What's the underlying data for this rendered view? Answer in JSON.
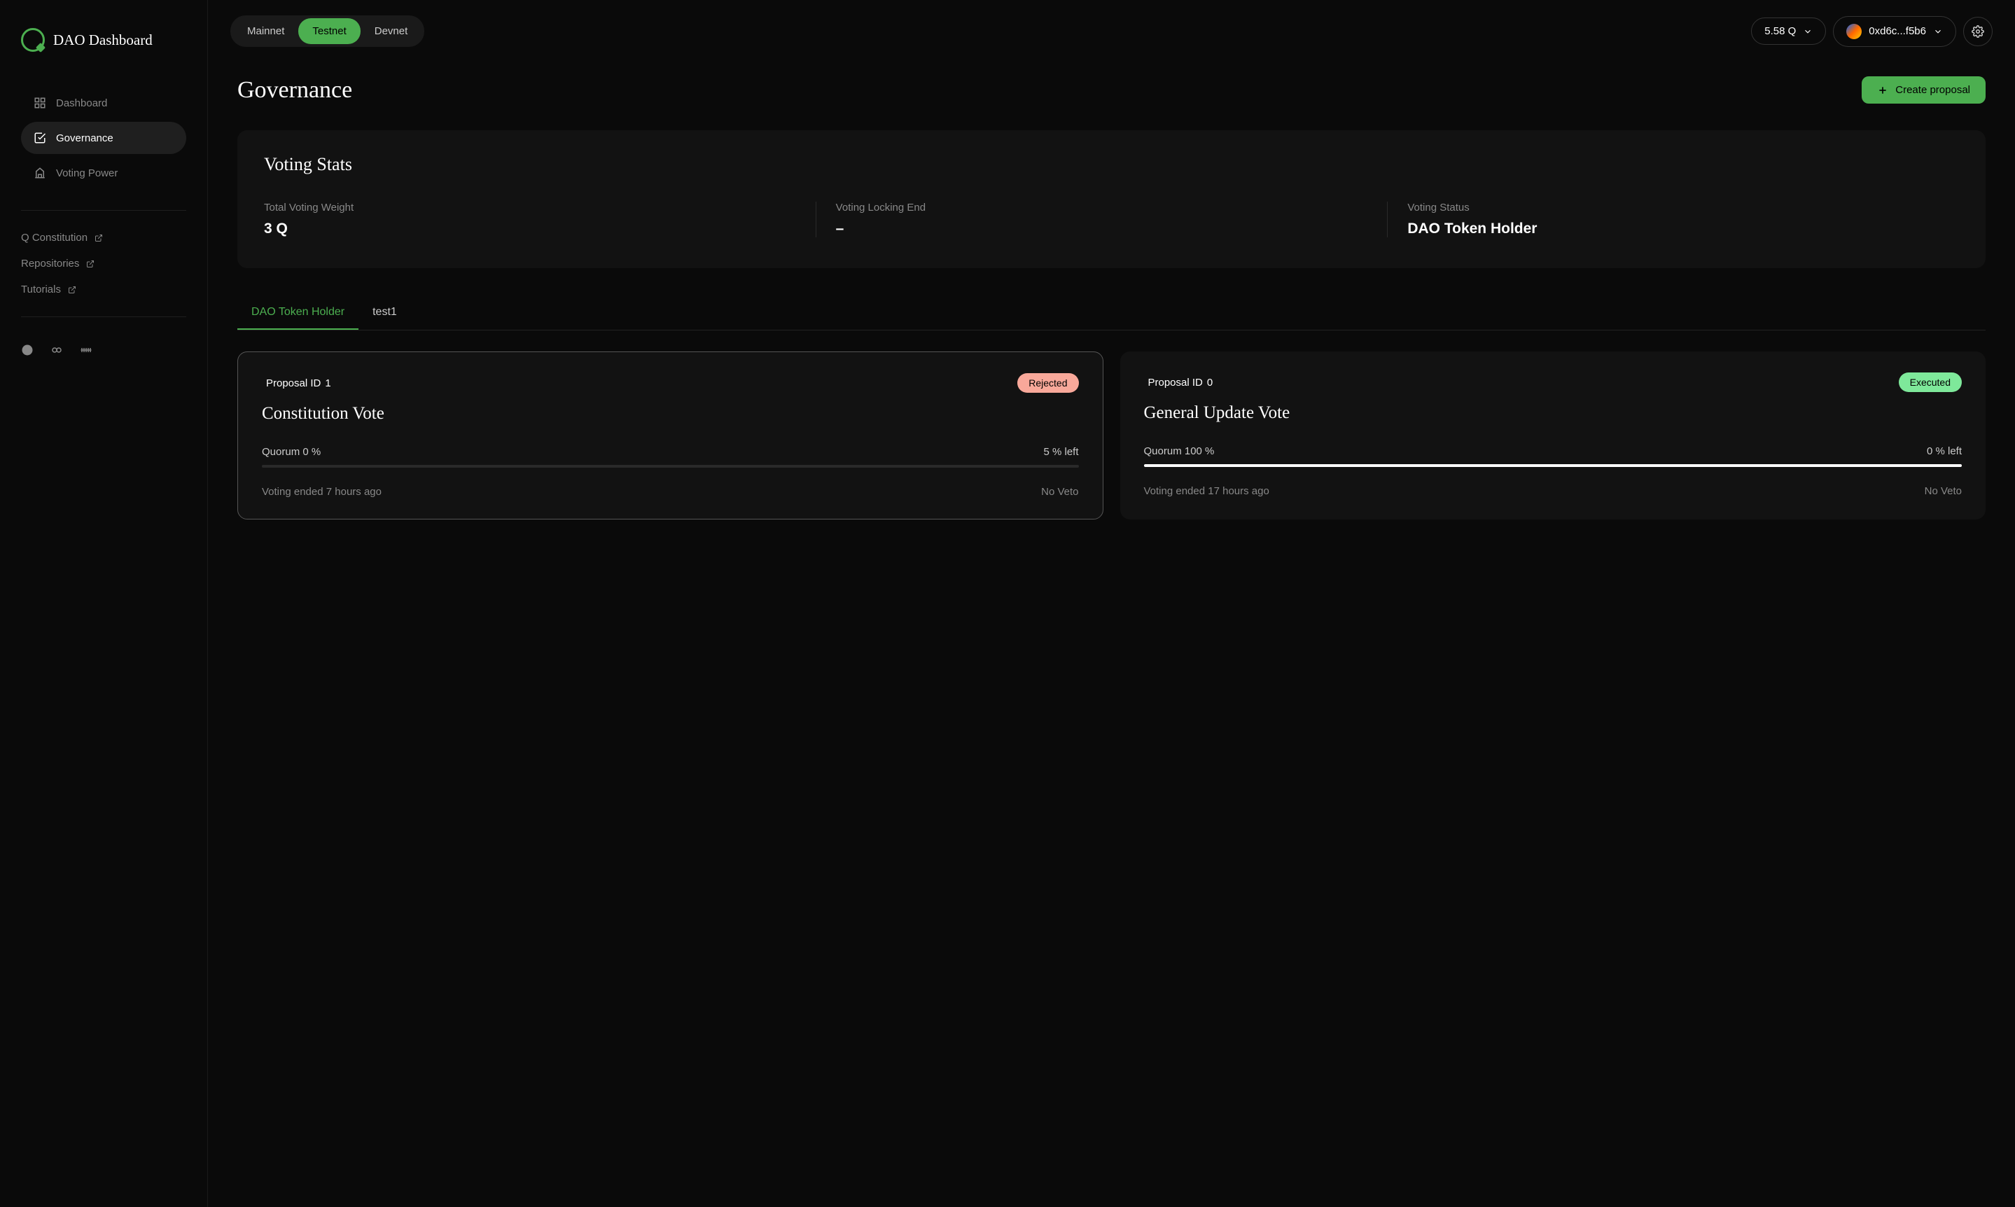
{
  "app_name": "DAO Dashboard",
  "sidebar": {
    "nav": [
      {
        "label": "Dashboard"
      },
      {
        "label": "Governance"
      },
      {
        "label": "Voting Power"
      }
    ],
    "links": [
      {
        "label": "Q Constitution"
      },
      {
        "label": "Repositories"
      },
      {
        "label": "Tutorials"
      }
    ]
  },
  "topbar": {
    "networks": [
      "Mainnet",
      "Testnet",
      "Devnet"
    ],
    "balance": "5.58 Q",
    "wallet": "0xd6c...f5b6"
  },
  "page": {
    "title": "Governance",
    "create_label": "Create proposal"
  },
  "stats": {
    "title": "Voting Stats",
    "items": [
      {
        "label": "Total Voting Weight",
        "value": "3 Q"
      },
      {
        "label": "Voting Locking End",
        "value": "–"
      },
      {
        "label": "Voting Status",
        "value": "DAO Token Holder"
      }
    ]
  },
  "tabs": [
    "DAO Token Holder",
    "test1"
  ],
  "proposals": [
    {
      "id_label": "Proposal ID",
      "id": "1",
      "status": "Rejected",
      "title": "Constitution Vote",
      "quorum_label": "Quorum 0 %",
      "left_label": "5 % left",
      "progress_pct": 0,
      "ended": "Voting ended 7 hours ago",
      "veto": "No Veto"
    },
    {
      "id_label": "Proposal ID",
      "id": "0",
      "status": "Executed",
      "title": "General Update Vote",
      "quorum_label": "Quorum 100 %",
      "left_label": "0 % left",
      "progress_pct": 100,
      "ended": "Voting ended 17 hours ago",
      "veto": "No Veto"
    }
  ]
}
